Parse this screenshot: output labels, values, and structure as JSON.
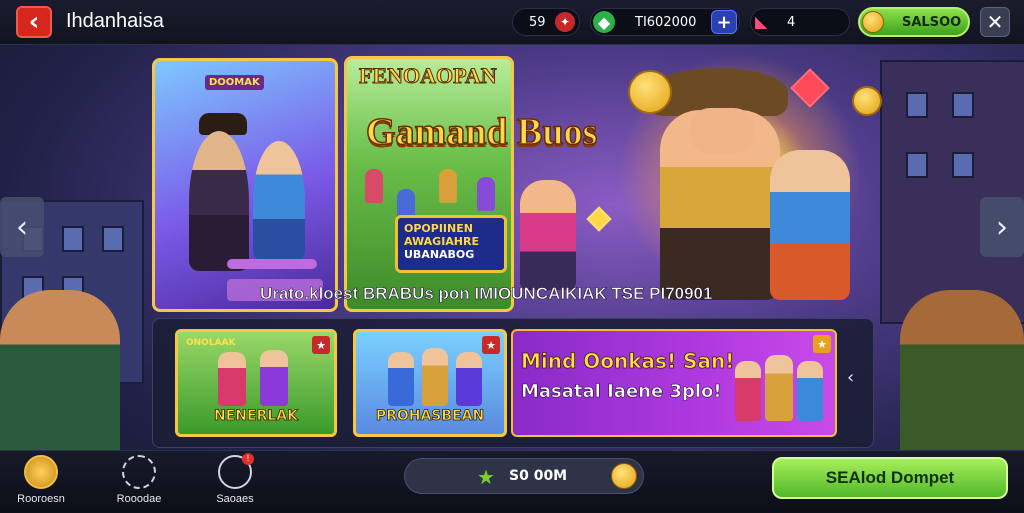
{
  "topbar": {
    "title": "Ihdanhaisa",
    "currency_a": "59",
    "currency_b": "TI602000",
    "currency_c": "4",
    "coins": "SALSOO",
    "plus_label": "+",
    "close_label": "✕",
    "back_label": "‹"
  },
  "hero": {
    "card_a_tag": "DOOMAK",
    "card_b_title": "FENOAOPAN",
    "main_title": "Gamand Buos",
    "sign_line1": "OPOPIINEN AWAGIAHRE",
    "sign_line2": "UBANABOG",
    "promo_text": "Urato.kloest BRABUs pon IMIOUNCAIKIAK TSE PI70901"
  },
  "tiles": [
    {
      "label": "NENERLAK",
      "top_tag": "ONOLAAK"
    },
    {
      "label": "PROHASBEAN"
    },
    {
      "line1": "Mind Oonkas! San!",
      "line2": "Masatal Iaene 3plo!"
    }
  ],
  "nav": {
    "prev": "‹",
    "next": "›",
    "panel_arrow": "‹"
  },
  "bottombar": {
    "items": [
      {
        "label": "Rooroesn"
      },
      {
        "label": "Rooodae"
      },
      {
        "label": "Saoaes"
      }
    ],
    "badge": "!",
    "balance": "S0 00M",
    "cta": "SEAlod Dompet"
  },
  "colors": {
    "accent_green": "#52b82a",
    "accent_gold": "#f4c842",
    "back_red": "#d7261e"
  }
}
